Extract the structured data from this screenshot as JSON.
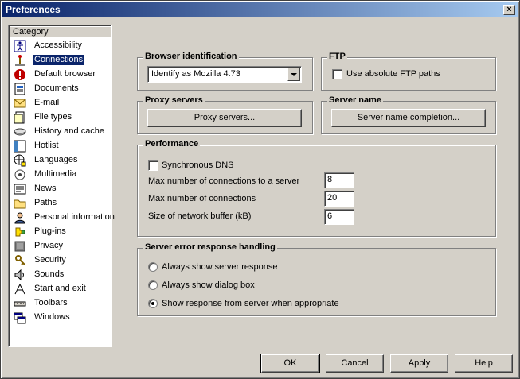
{
  "window": {
    "title": "Preferences",
    "close_glyph": "×"
  },
  "sidebar": {
    "header": "Category",
    "items": [
      {
        "label": "Accessibility",
        "icon": "accessibility-icon"
      },
      {
        "label": "Connections",
        "icon": "connections-icon",
        "selected": true
      },
      {
        "label": "Default browser",
        "icon": "default-browser-icon"
      },
      {
        "label": "Documents",
        "icon": "documents-icon"
      },
      {
        "label": "E-mail",
        "icon": "email-icon"
      },
      {
        "label": "File types",
        "icon": "file-types-icon"
      },
      {
        "label": "History and cache",
        "icon": "history-icon"
      },
      {
        "label": "Hotlist",
        "icon": "hotlist-icon"
      },
      {
        "label": "Languages",
        "icon": "languages-icon"
      },
      {
        "label": "Multimedia",
        "icon": "multimedia-icon"
      },
      {
        "label": "News",
        "icon": "news-icon"
      },
      {
        "label": "Paths",
        "icon": "paths-icon"
      },
      {
        "label": "Personal information",
        "icon": "personal-info-icon"
      },
      {
        "label": "Plug-ins",
        "icon": "plugins-icon"
      },
      {
        "label": "Privacy",
        "icon": "privacy-icon"
      },
      {
        "label": "Security",
        "icon": "security-icon"
      },
      {
        "label": "Sounds",
        "icon": "sounds-icon"
      },
      {
        "label": "Start and exit",
        "icon": "start-exit-icon"
      },
      {
        "label": "Toolbars",
        "icon": "toolbars-icon"
      },
      {
        "label": "Windows",
        "icon": "windows-icon"
      }
    ]
  },
  "browser_id": {
    "title": "Browser identification",
    "value": "Identify as Mozilla 4.73"
  },
  "ftp": {
    "title": "FTP",
    "absolute_paths_label": "Use absolute FTP paths",
    "absolute_paths_checked": false
  },
  "proxy": {
    "title": "Proxy servers",
    "button": "Proxy servers..."
  },
  "server_name": {
    "title": "Server name",
    "button": "Server name completion..."
  },
  "performance": {
    "title": "Performance",
    "sync_dns_label": "Synchronous DNS",
    "sync_dns_checked": false,
    "max_per_server_label": "Max number of connections to a server",
    "max_per_server_value": "8",
    "max_connections_label": "Max number of connections",
    "max_connections_value": "20",
    "buffer_label": "Size of network buffer (kB)",
    "buffer_value": "6"
  },
  "error_handling": {
    "title": "Server error response handling",
    "options": [
      "Always show server response",
      "Always show dialog box",
      "Show response from server when appropriate"
    ],
    "selected_index": 2
  },
  "footer": {
    "ok": "OK",
    "cancel": "Cancel",
    "apply": "Apply",
    "help": "Help"
  },
  "colors": {
    "selection": "#0a246a",
    "face": "#d4d0c8"
  }
}
